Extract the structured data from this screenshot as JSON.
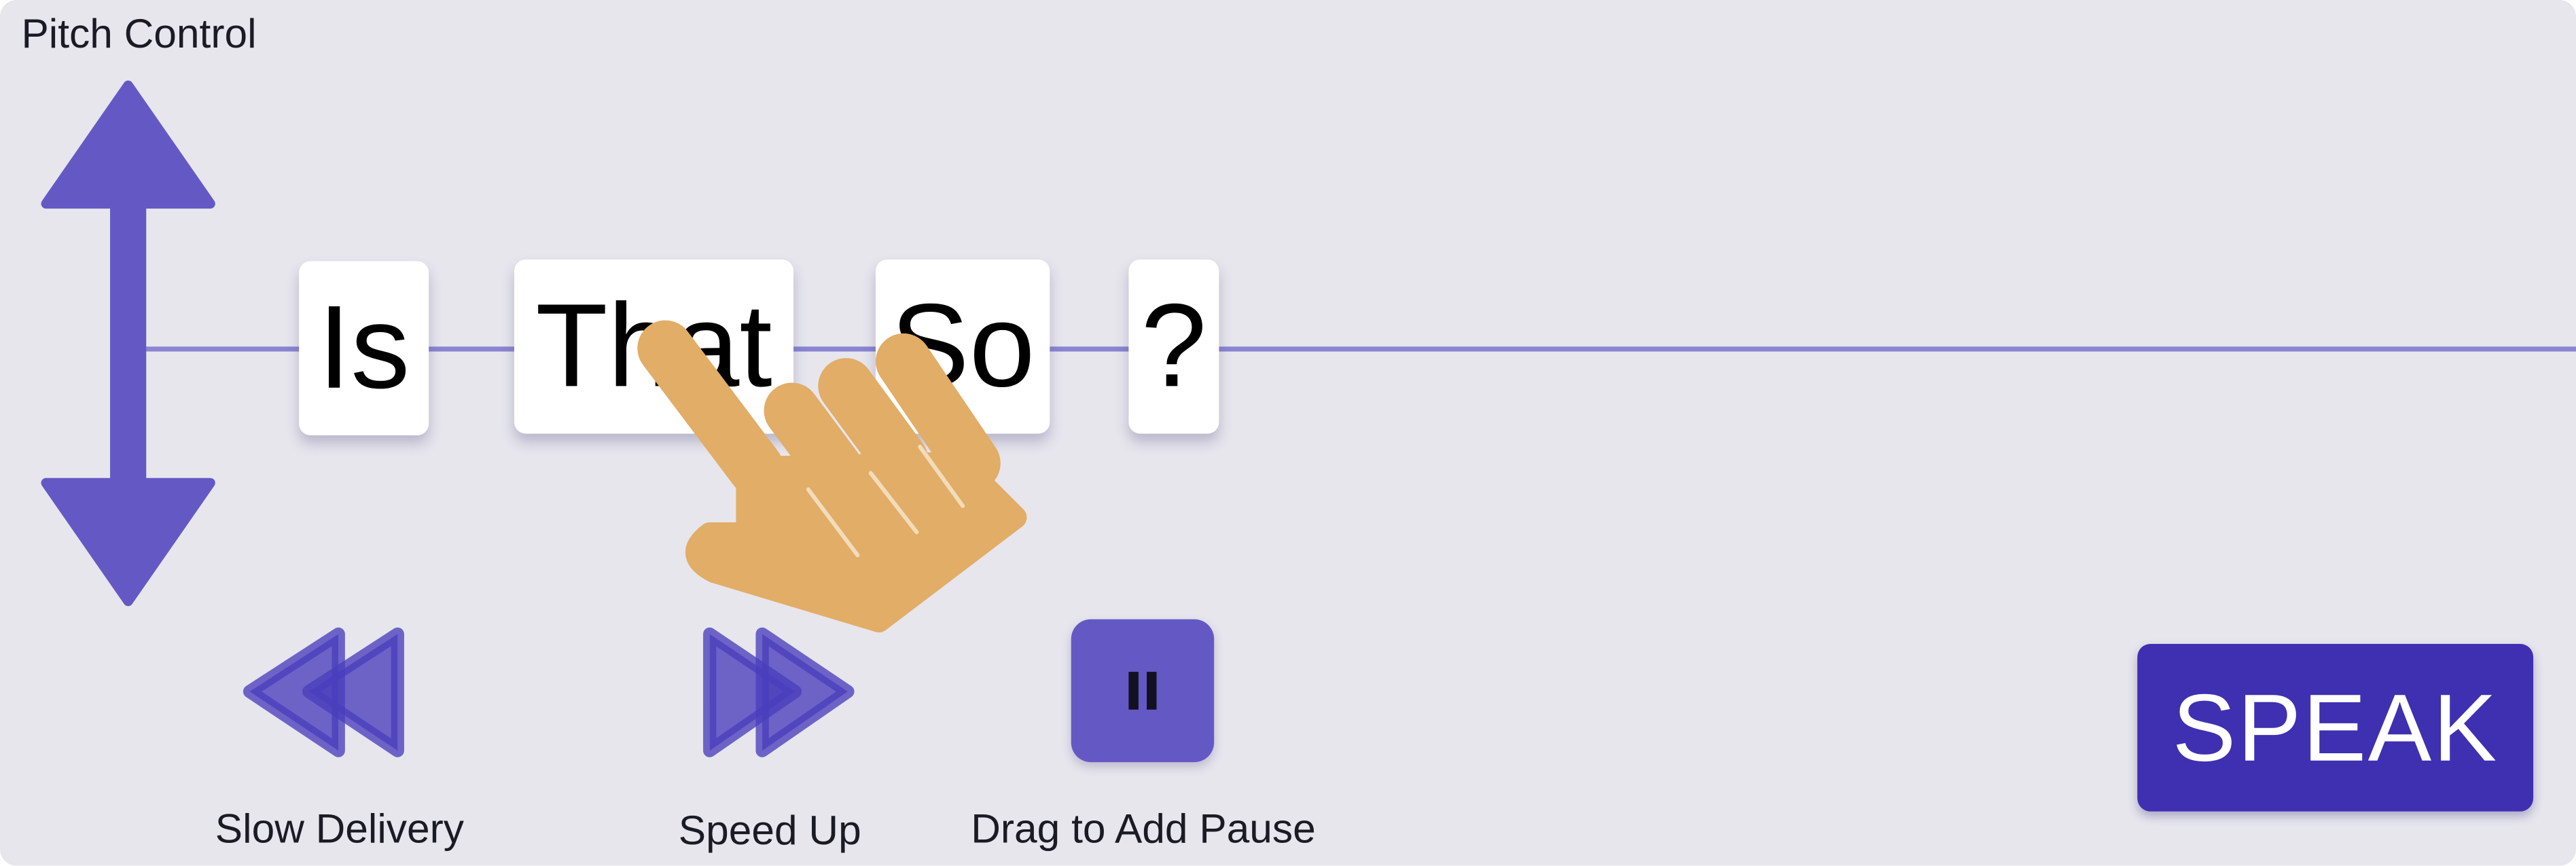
{
  "panel": {
    "title": "Pitch Control"
  },
  "words": [
    {
      "text": "Is"
    },
    {
      "text": "That"
    },
    {
      "text": "So"
    },
    {
      "text": "?"
    }
  ],
  "controls": {
    "slow_label": "Slow Delivery",
    "speed_label": "Speed Up",
    "pause_label": "Drag to Add Pause",
    "speak_label": "SPEAK"
  },
  "icons": {
    "pitch": "up-down-arrow-icon",
    "hand": "pointing-hand-icon",
    "slow": "rewind-icon",
    "speed": "fast-forward-icon",
    "pause": "pause-icon"
  },
  "colors": {
    "background": "#e7e6ed",
    "accent": "#6459c4",
    "speak_button": "#3e30b0",
    "pitch_line": "#8a85d2",
    "hand": "#e1ad67"
  }
}
